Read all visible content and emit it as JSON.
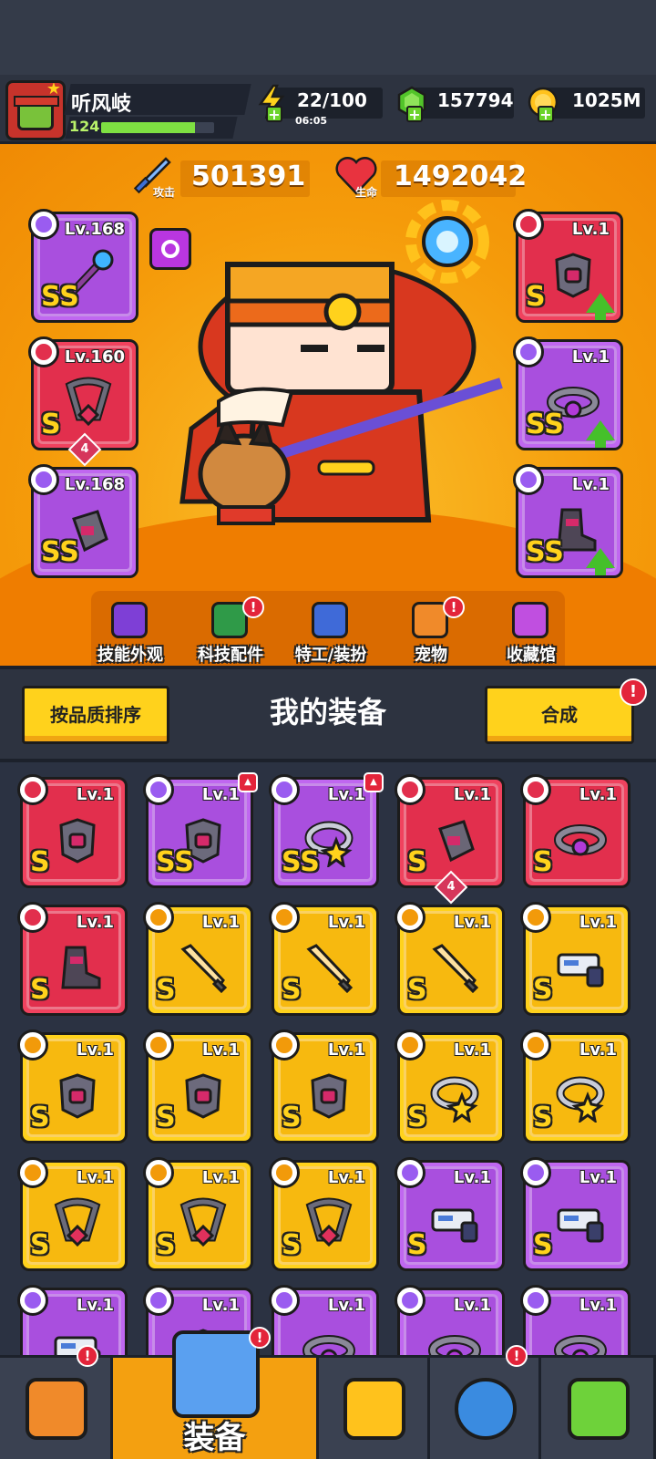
{
  "player": {
    "name": "听风岐",
    "level": "124",
    "xp_fraction": 0.83
  },
  "resources": {
    "energy": {
      "value": "22/100",
      "timer": "06:05",
      "icon": "lightning-icon"
    },
    "gems": {
      "value": "157794",
      "icon": "gem-icon"
    },
    "coins": {
      "value": "1025M",
      "icon": "coin-icon"
    }
  },
  "stats": {
    "attack": {
      "value": "501391",
      "label": "攻击",
      "icon": "sword-icon"
    },
    "life": {
      "value": "1492042",
      "label": "生命",
      "icon": "heart-icon"
    }
  },
  "equipped_left": [
    {
      "level": "Lv.168",
      "grade": "SS",
      "type": "weapon",
      "color": "purple",
      "icon": "staff-icon"
    },
    {
      "level": "Lv.160",
      "grade": "S",
      "type": "necklace",
      "color": "red",
      "icon": "chain-necklace-icon",
      "count": "4"
    },
    {
      "level": "Lv.168",
      "grade": "SS",
      "type": "glove",
      "color": "purple",
      "icon": "gauntlet-icon"
    }
  ],
  "equipped_right": [
    {
      "level": "Lv.1",
      "grade": "S",
      "type": "armor",
      "color": "red",
      "icon": "armor-icon",
      "upgrade": true
    },
    {
      "level": "Lv.1",
      "grade": "SS",
      "type": "belt",
      "color": "purple",
      "icon": "belt-icon",
      "upgrade": true
    },
    {
      "level": "Lv.1",
      "grade": "SS",
      "type": "boots",
      "color": "purple",
      "icon": "boot-icon",
      "upgrade": true
    }
  ],
  "hero_tabs": [
    {
      "label": "技能外观",
      "icon": "hat-icon",
      "alert": false
    },
    {
      "label": "科技配件",
      "icon": "tech-chip-icon",
      "alert": true
    },
    {
      "label": "特工/装扮",
      "icon": "agent-icon",
      "alert": false
    },
    {
      "label": "宠物",
      "icon": "shiba-pet-icon",
      "alert": true
    },
    {
      "label": "收藏馆",
      "icon": "treasure-chest-icon",
      "alert": false
    }
  ],
  "toolbar": {
    "sort_label": "按品质排序",
    "title": "我的装备",
    "merge_label": "合成",
    "merge_alert": "!"
  },
  "inventory": [
    {
      "level": "Lv.1",
      "grade": "S",
      "color": "red",
      "type": "armor",
      "icon": "armor-icon"
    },
    {
      "level": "Lv.1",
      "grade": "SS",
      "color": "purple",
      "type": "armor",
      "icon": "belt-armor-icon",
      "corner": true
    },
    {
      "level": "Lv.1",
      "grade": "SS",
      "color": "purple",
      "type": "necklace",
      "icon": "star-ring-icon",
      "corner": true
    },
    {
      "level": "Lv.1",
      "grade": "S",
      "color": "red",
      "type": "glove",
      "icon": "gauntlet-icon",
      "count": "4"
    },
    {
      "level": "Lv.1",
      "grade": "S",
      "color": "red",
      "type": "belt",
      "icon": "belt-icon"
    },
    {
      "level": "Lv.1",
      "grade": "S",
      "color": "red",
      "type": "boots",
      "icon": "boot-icon"
    },
    {
      "level": "Lv.1",
      "grade": "S",
      "color": "yellow",
      "type": "weapon",
      "icon": "sword-icon"
    },
    {
      "level": "Lv.1",
      "grade": "S",
      "color": "yellow",
      "type": "weapon",
      "icon": "sword-icon"
    },
    {
      "level": "Lv.1",
      "grade": "S",
      "color": "yellow",
      "type": "weapon",
      "icon": "sword-icon"
    },
    {
      "level": "Lv.1",
      "grade": "S",
      "color": "yellow",
      "type": "weapon",
      "icon": "blaster-icon"
    },
    {
      "level": "Lv.1",
      "grade": "S",
      "color": "yellow",
      "type": "armor",
      "icon": "armor-icon"
    },
    {
      "level": "Lv.1",
      "grade": "S",
      "color": "yellow",
      "type": "armor",
      "icon": "armor-icon"
    },
    {
      "level": "Lv.1",
      "grade": "S",
      "color": "yellow",
      "type": "armor",
      "icon": "armor-icon"
    },
    {
      "level": "Lv.1",
      "grade": "S",
      "color": "yellow",
      "type": "necklace",
      "icon": "star-ring-icon"
    },
    {
      "level": "Lv.1",
      "grade": "S",
      "color": "yellow",
      "type": "necklace",
      "icon": "star-ring-icon"
    },
    {
      "level": "Lv.1",
      "grade": "S",
      "color": "yellow",
      "type": "necklace",
      "icon": "chain-necklace-icon"
    },
    {
      "level": "Lv.1",
      "grade": "S",
      "color": "yellow",
      "type": "necklace",
      "icon": "chain-necklace-icon"
    },
    {
      "level": "Lv.1",
      "grade": "S",
      "color": "yellow",
      "type": "necklace",
      "icon": "chain-necklace-icon"
    },
    {
      "level": "Lv.1",
      "grade": "S",
      "color": "purple",
      "type": "weapon",
      "icon": "blaster-icon"
    },
    {
      "level": "Lv.1",
      "grade": "S",
      "color": "purple",
      "type": "weapon",
      "icon": "blaster-icon"
    },
    {
      "level": "Lv.1",
      "grade": "",
      "color": "purple",
      "type": "weapon",
      "icon": "blaster-icon"
    },
    {
      "level": "Lv.1",
      "grade": "",
      "color": "purple",
      "type": "armor",
      "icon": "armor-icon"
    },
    {
      "level": "Lv.1",
      "grade": "",
      "color": "purple",
      "type": "necklace",
      "icon": "belt-icon"
    },
    {
      "level": "Lv.1",
      "grade": "",
      "color": "purple",
      "type": "belt",
      "icon": "belt-icon"
    },
    {
      "level": "Lv.1",
      "grade": "",
      "color": "purple",
      "type": "belt",
      "icon": "belt-icon"
    }
  ],
  "bottom_nav": [
    {
      "label": "",
      "icon": "shop-icon",
      "alert": true
    },
    {
      "label": "装备",
      "icon": "equipment-icon",
      "alert": true,
      "active": true
    },
    {
      "label": "",
      "icon": "battle-star-icon",
      "alert": false
    },
    {
      "label": "",
      "icon": "planet-icon",
      "alert": true
    },
    {
      "label": "",
      "icon": "gene-tube-icon",
      "alert": false
    }
  ],
  "colors": {
    "red": "#f0425e",
    "red_inner": "#e22f4d",
    "purple": "#c067f0",
    "purple_inner": "#a94fde",
    "yellow": "#ffd21c",
    "yellow_inner": "#f7b90f",
    "lilac": "#d9c6ff",
    "lilac_inner": "#c6b0f5",
    "accent": "#f4a010"
  }
}
